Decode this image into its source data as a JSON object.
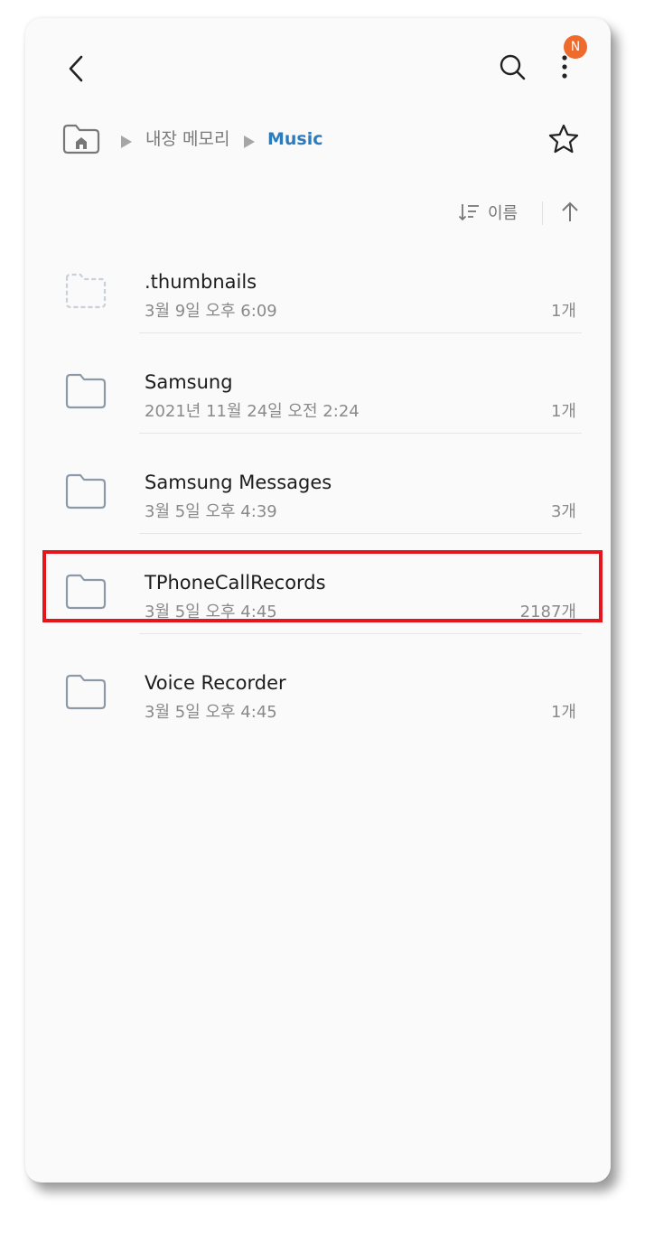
{
  "header": {
    "back_icon": "chevron-left-icon",
    "search_icon": "search-icon",
    "more_icon": "more-vertical-icon",
    "badge": "N",
    "badge_color": "#ee6a2d"
  },
  "breadcrumb": {
    "home_icon": "folder-home-icon",
    "items": [
      "내장 메모리",
      "Music"
    ],
    "active_color": "#2d7bbd",
    "star_icon": "star-outline-icon"
  },
  "sort": {
    "label": "이름",
    "sort_icon": "sort-icon",
    "direction_icon": "arrow-up-icon"
  },
  "files": [
    {
      "name": ".thumbnails",
      "date": "3월 9일 오후 6:09",
      "count": "1개",
      "icon": "folder-hidden-icon"
    },
    {
      "name": "Samsung",
      "date": "2021년 11월 24일 오전 2:24",
      "count": "1개",
      "icon": "folder-icon"
    },
    {
      "name": "Samsung Messages",
      "date": "3월 5일 오후 4:39",
      "count": "3개",
      "icon": "folder-icon"
    },
    {
      "name": "TPhoneCallRecords",
      "date": "3월 5일 오후 4:45",
      "count": "2187개",
      "icon": "folder-icon",
      "highlighted": true
    },
    {
      "name": "Voice Recorder",
      "date": "3월 5일 오후 4:45",
      "count": "1개",
      "icon": "folder-icon"
    }
  ],
  "highlight_color": "#e4161b"
}
